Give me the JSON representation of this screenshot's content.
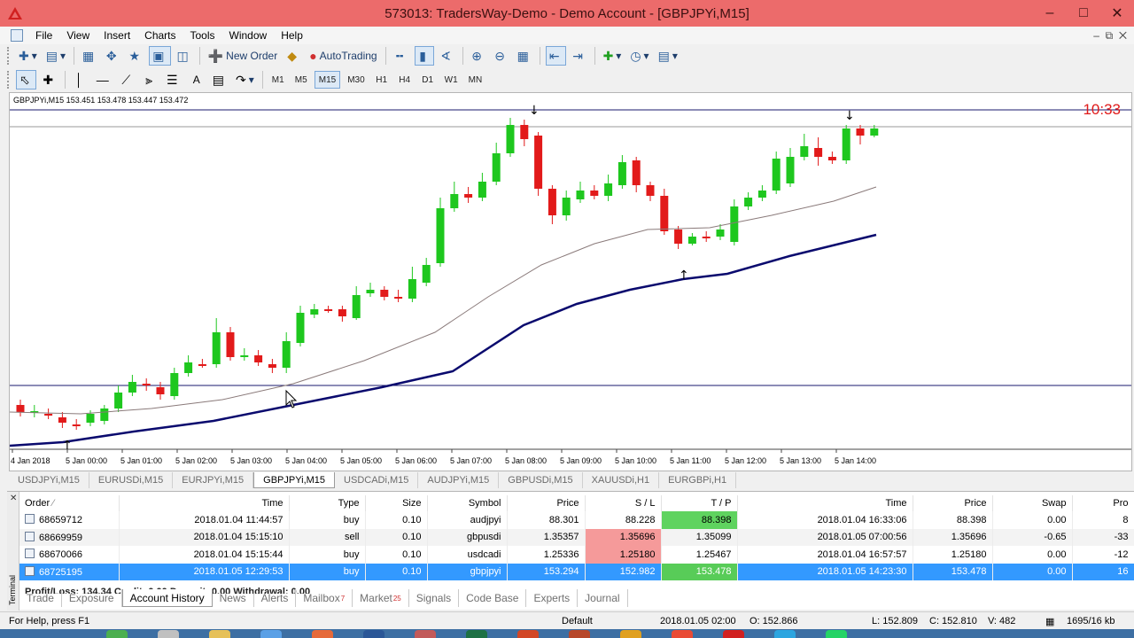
{
  "window": {
    "title": "573013: TradersWay-Demo - Demo Account - [GBPJPYi,M15]"
  },
  "menu": {
    "items": [
      "File",
      "View",
      "Insert",
      "Charts",
      "Tools",
      "Window",
      "Help"
    ]
  },
  "toolbar": {
    "new_order": "New Order",
    "autotrading": "AutoTrading",
    "timeframes": [
      "M1",
      "M5",
      "M15",
      "M30",
      "H1",
      "H4",
      "D1",
      "W1",
      "MN"
    ],
    "active_timeframe": "M15"
  },
  "chart": {
    "info": "GBPJPYi,M15  153.451 153.478 153.447 153.472",
    "clock": "10:33",
    "time_labels": [
      "4 Jan 2018",
      "5 Jan 00:00",
      "5 Jan 01:00",
      "5 Jan 02:00",
      "5 Jan 03:00",
      "5 Jan 04:00",
      "5 Jan 05:00",
      "5 Jan 06:00",
      "5 Jan 07:00",
      "5 Jan 08:00",
      "5 Jan 09:00",
      "5 Jan 10:00",
      "5 Jan 11:00",
      "5 Jan 12:00",
      "5 Jan 13:00",
      "5 Jan 14:00"
    ],
    "colors": {
      "bull": "#1ec71e",
      "bear": "#e21a1a",
      "ma_slow": "#0a0a6e",
      "ma_fast": "#8a7a7a"
    }
  },
  "chart_tabs": [
    "USDJPYi,M15",
    "EURUSDi,M15",
    "EURJPYi,M15",
    "GBPJPYi,M15",
    "USDCADi,M15",
    "AUDJPYi,M15",
    "GBPUSDi,M15",
    "XAUUSDi,H1",
    "EURGBPi,H1"
  ],
  "active_chart_tab": 3,
  "terminal": {
    "side_label": "Terminal",
    "columns": [
      "Order",
      "Time",
      "Type",
      "Size",
      "Symbol",
      "Price",
      "S / L",
      "T / P",
      "Time",
      "Price",
      "Swap",
      "Pro"
    ],
    "rows": [
      [
        "68659712",
        "2018.01.04 11:44:57",
        "buy",
        "0.10",
        "audjpyi",
        "88.301",
        "88.228",
        "88.398",
        "2018.01.04 16:33:06",
        "88.398",
        "0.00",
        "8"
      ],
      [
        "68669959",
        "2018.01.04 15:15:10",
        "sell",
        "0.10",
        "gbpusdi",
        "1.35357",
        "1.35696",
        "1.35099",
        "2018.01.05 07:00:56",
        "1.35696",
        "-0.65",
        "-33"
      ],
      [
        "68670066",
        "2018.01.04 15:15:44",
        "buy",
        "0.10",
        "usdcadi",
        "1.25336",
        "1.25180",
        "1.25467",
        "2018.01.04 16:57:57",
        "1.25180",
        "0.00",
        "-12"
      ],
      [
        "68725195",
        "2018.01.05 12:29:53",
        "buy",
        "0.10",
        "gbpjpyi",
        "153.294",
        "152.982",
        "153.478",
        "2018.01.05 14:23:30",
        "153.478",
        "0.00",
        "16"
      ]
    ],
    "profit_summary": "Profit/Loss: 134.34  Credit: 0.00  Deposit: 0.00  Withdrawal: 0.00",
    "tabs": [
      "Trade",
      "Exposure",
      "Account History",
      "News",
      "Alerts",
      "Mailbox",
      "Market",
      "Signals",
      "Code Base",
      "Experts",
      "Journal"
    ],
    "mailbox_count": "7",
    "market_count": "25",
    "active_tab": "Account History"
  },
  "status": {
    "help": "For Help, press F1",
    "profile": "Default",
    "time": "2018.01.05 02:00",
    "open": "O: 152.866",
    "low": "L: 152.809",
    "close": "C: 152.810",
    "volume": "V: 482",
    "traffic": "1695/16 kb"
  }
}
